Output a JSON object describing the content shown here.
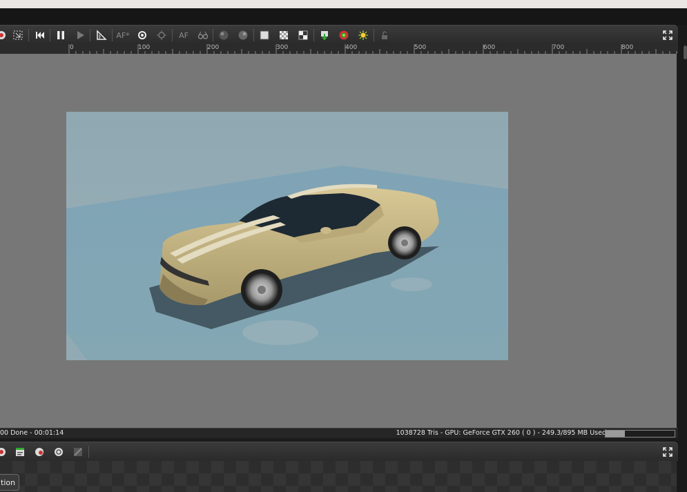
{
  "toolbar": {
    "af_star_label": "AF*",
    "af_label": "AF",
    "buttons": [
      "render-icon",
      "region-icon",
      "rewind-icon",
      "pause-icon",
      "play-icon",
      "ruler-icon",
      "af-star-toggle",
      "refresh-icon",
      "light-icon",
      "af-toggle",
      "glasses-icon",
      "sphere-dark-icon",
      "sphere-light-icon",
      "white-square-icon",
      "checker-icon",
      "alpha-icon",
      "import-icon",
      "color-icon",
      "sun-icon",
      "lock-icon",
      "maximize-icon"
    ]
  },
  "ruler": {
    "labels": [
      "0",
      "100",
      "200",
      "300",
      "400",
      "500",
      "600",
      "700",
      "800"
    ]
  },
  "status": {
    "left_text": "00 Done - 00:01:14",
    "right_text": "1038728 Tris - GPU: GeForce GTX 260 ( 0 ) - 249.3/895 MB Used",
    "memory_used_fraction": 0.2786
  },
  "lower_toolbar": {
    "buttons": [
      "render-icon",
      "clapper-icon",
      "material-icon",
      "sphere-icon",
      "material-disabled-icon",
      "maximize-icon"
    ]
  },
  "bottom_tab": {
    "label": "tion"
  },
  "colors": {
    "viewport_bg": "#777777",
    "toolbar_bg": "#333333",
    "render_sky": "#8fa8b2",
    "car_body": "#c4b27f"
  }
}
